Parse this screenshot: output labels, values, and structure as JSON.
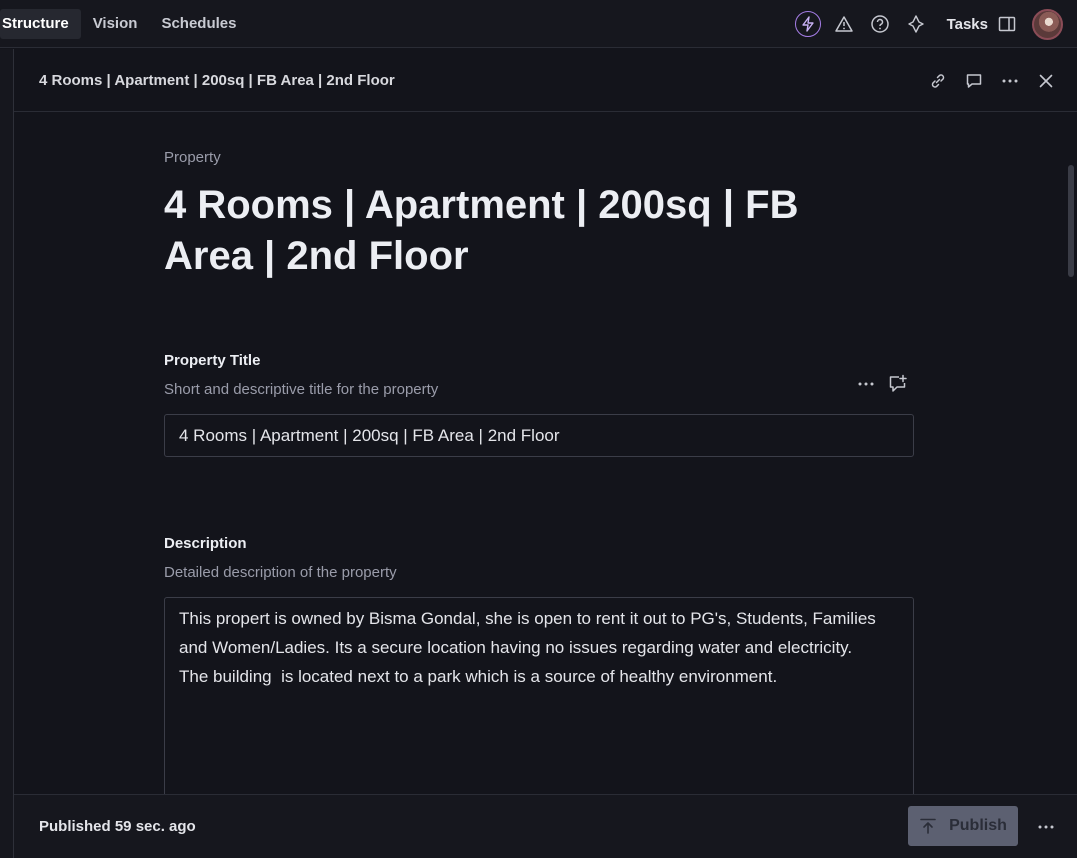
{
  "nav": {
    "tabs": [
      {
        "label": "Structure",
        "active": true
      },
      {
        "label": "Vision"
      },
      {
        "label": "Schedules"
      }
    ]
  },
  "topbar": {
    "tasks_label": "Tasks",
    "icons": [
      "bolt-icon",
      "warning-icon",
      "help-icon",
      "community-icon",
      "panel-toggle-icon"
    ]
  },
  "panel": {
    "title": "4 Rooms | Apartment | 200sq | FB Area | 2nd Floor"
  },
  "document": {
    "type_label": "Property",
    "title": "4 Rooms | Apartment | 200sq | FB Area | 2nd Floor"
  },
  "fields": {
    "title": {
      "label": "Property Title",
      "description": "Short and descriptive title for the property",
      "value": "4 Rooms | Apartment | 200sq | FB Area | 2nd Floor"
    },
    "description": {
      "label": "Description",
      "description": "Detailed description of the property",
      "value": "This propert is owned by Bisma Gondal, she is open to rent it out to PG's, Students, Families and Women/Ladies. Its a secure location having no issues regarding water and electricity.\nThe building  is located next to a park which is a source of healthy environment."
    }
  },
  "footer": {
    "status": "Published 59 sec. ago",
    "publish_label": "Publish"
  },
  "colors": {
    "background": "#13141b",
    "accent_bolt": "#a57de6",
    "publish_button": "#5c6071"
  }
}
